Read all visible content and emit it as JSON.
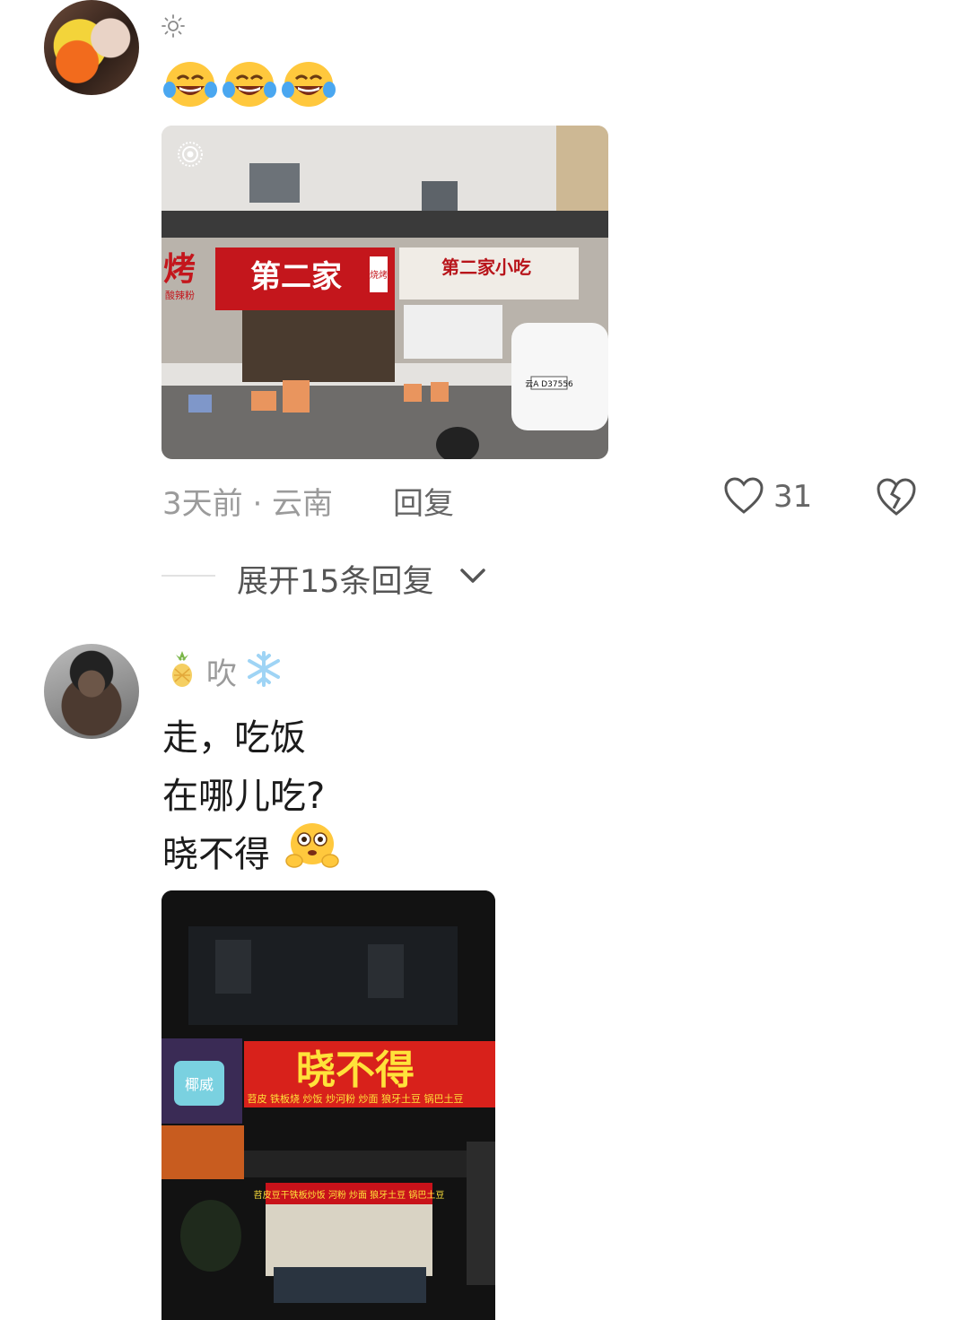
{
  "comment1": {
    "emoji_row": [
      "laugh-cry-icon",
      "laugh-cry-icon",
      "laugh-cry-icon"
    ],
    "photo": {
      "sign_main": "第二家",
      "sign_side": "烧烤",
      "sign_right": "第二家小吃",
      "sign_left": "烤",
      "sign_left_small": "酸辣粉",
      "plate": "云A D37556"
    },
    "time_location": "3天前 · 云南",
    "reply_label": "回复",
    "like_count": "31",
    "expand_replies": "展开15条回复"
  },
  "comment2": {
    "username": "吹",
    "lines": [
      "走，吃饭",
      "在哪儿吃?",
      "晓不得"
    ],
    "photo": {
      "sign_main": "晓不得",
      "sign_sub": "苕皮 铁板烧 炒饭 炒河粉 炒面 狼牙土豆 锅巴土豆",
      "sign_lower": "苕皮豆干铁板炒饭 河粉 炒面 狼牙土豆 锅巴土豆",
      "sign_left": "椰威"
    }
  },
  "colors": {
    "meta_gray": "#9b9b9b",
    "text_dark": "#1b1b1b",
    "sign_red": "#d8211b",
    "sign_yellow": "#ffe23a"
  }
}
